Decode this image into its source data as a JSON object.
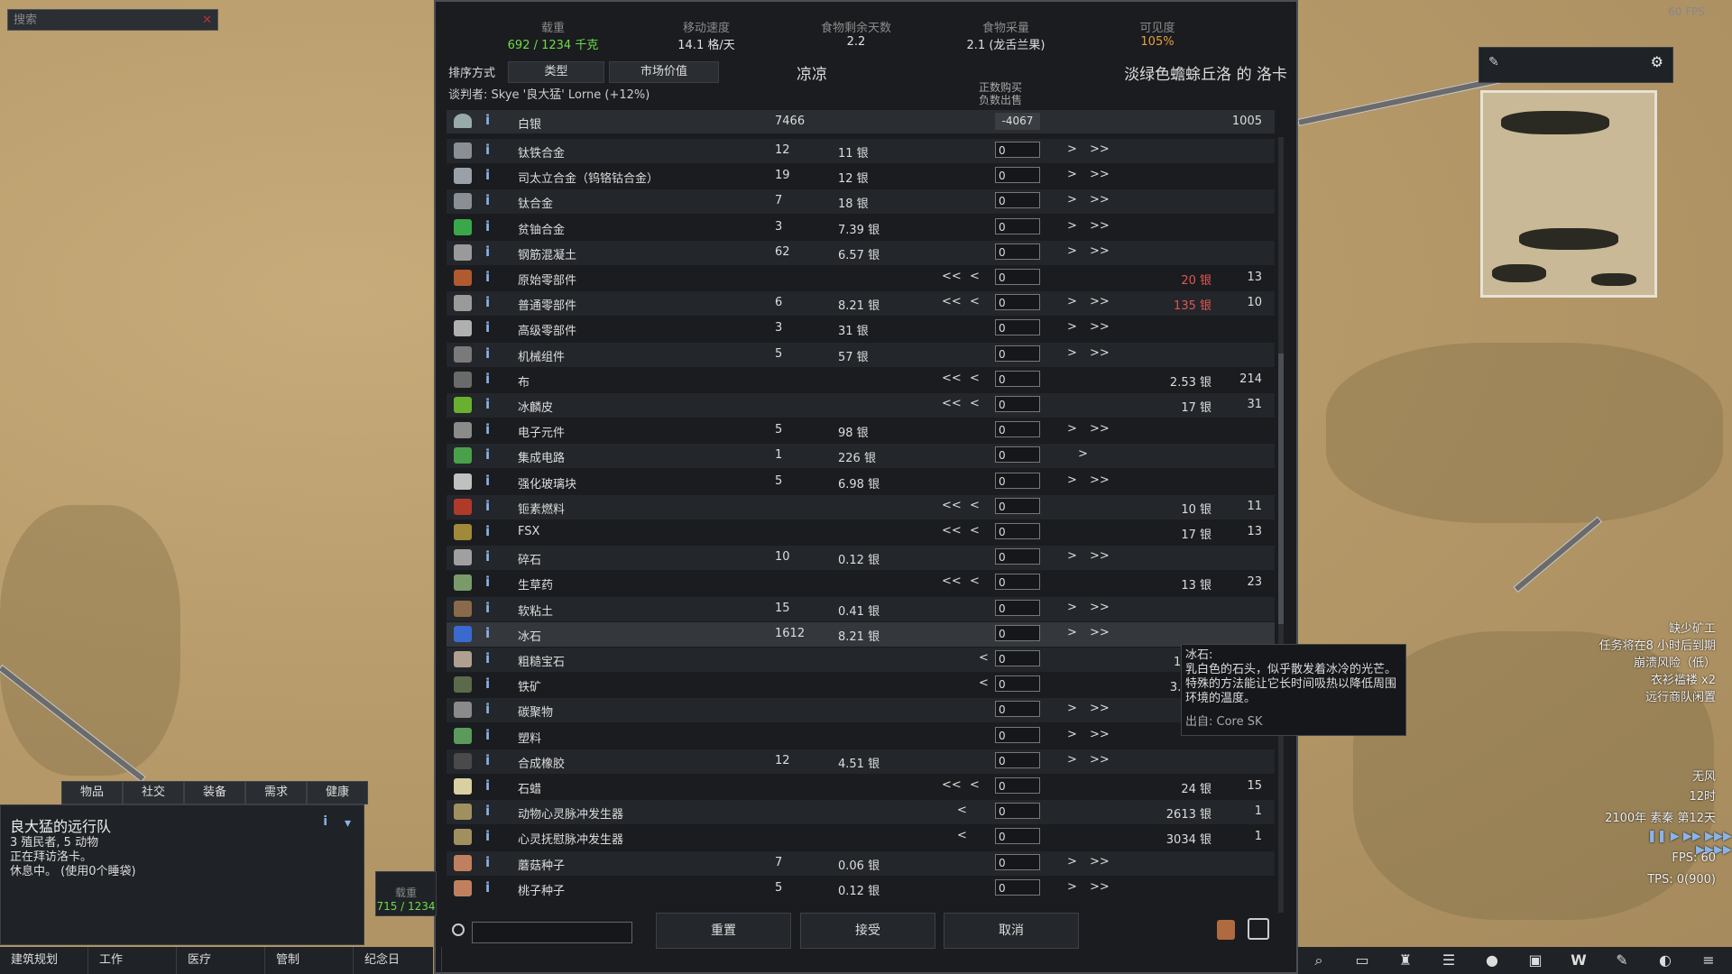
{
  "search": {
    "placeholder": "搜索"
  },
  "top_right": {
    "fps": "60 FPS"
  },
  "stats": [
    {
      "label": "载重",
      "value": "692 / 1234 千克",
      "color": "#6fdc4a"
    },
    {
      "label": "移动速度",
      "value": "14.1 格/天",
      "color": "#e0e0e0"
    },
    {
      "label": "食物剩余天数",
      "value": "2.2",
      "color": "#e0e0e0"
    },
    {
      "label": "食物采量",
      "value": "2.1 (龙舌兰果)",
      "color": "#e0e0e0"
    },
    {
      "label": "可见度",
      "value": "105%",
      "color": "#e8a040"
    }
  ],
  "sort": {
    "label": "排序方式",
    "btn1": "类型",
    "btn2": "市场价值"
  },
  "colony_name": "凉凉",
  "trader_name": "淡绿色蟾蜍丘洛 的 洛卡",
  "negotiator": "谈判者: Skye '良大猛' Lorne (+12%)",
  "hint": {
    "line1": "正数购买",
    "line2": "负数出售"
  },
  "silver": {
    "name": "白银",
    "colony_count": "7466",
    "qty": "-4067",
    "trader_count": "1005"
  },
  "rows": [
    {
      "icon_color": "#8a8f96",
      "name": "钛铁合金",
      "count": "12",
      "price": "11 银",
      "buy_left": false,
      "sell_right": true,
      "trader_price": "",
      "trader_count": "",
      "price_red": false
    },
    {
      "icon_color": "#9aa0a8",
      "name": "司太立合金（钨铬钴合金）",
      "count": "19",
      "price": "12 银",
      "buy_left": false,
      "sell_right": true,
      "trader_price": "",
      "trader_count": "",
      "price_red": false
    },
    {
      "icon_color": "#8a8f96",
      "name": "钛合金",
      "count": "7",
      "price": "18 银",
      "buy_left": false,
      "sell_right": true,
      "trader_price": "",
      "trader_count": "",
      "price_red": false
    },
    {
      "icon_color": "#3aa84a",
      "name": "贫铀合金",
      "count": "3",
      "price": "7.39 银",
      "buy_left": false,
      "sell_right": true,
      "trader_price": "",
      "trader_count": "",
      "price_red": false
    },
    {
      "icon_color": "#9a9a9a",
      "name": "钢筋混凝土",
      "count": "62",
      "price": "6.57 银",
      "buy_left": false,
      "sell_right": true,
      "trader_price": "",
      "trader_count": "",
      "price_red": false
    },
    {
      "icon_color": "#b05a30",
      "name": "原始零部件",
      "count": "",
      "price": "",
      "buy_left": true,
      "sell_right": false,
      "trader_price": "20 银",
      "trader_count": "13",
      "price_red": true
    },
    {
      "icon_color": "#9a9a9a",
      "name": "普通零部件",
      "count": "6",
      "price": "8.21 银",
      "buy_left": true,
      "sell_right": true,
      "trader_price": "135 银",
      "trader_count": "10",
      "price_red": true
    },
    {
      "icon_color": "#b0b0b0",
      "name": "高级零部件",
      "count": "3",
      "price": "31 银",
      "buy_left": false,
      "sell_right": true,
      "trader_price": "",
      "trader_count": "",
      "price_red": false
    },
    {
      "icon_color": "#7a7a7a",
      "name": "机械组件",
      "count": "5",
      "price": "57 银",
      "buy_left": false,
      "sell_right": true,
      "trader_price": "",
      "trader_count": "",
      "price_red": false
    },
    {
      "icon_color": "#6a6a6a",
      "name": "布",
      "count": "",
      "price": "",
      "buy_left": true,
      "sell_right": false,
      "trader_price": "2.53 银",
      "trader_count": "214",
      "price_red": false
    },
    {
      "icon_color": "#6ab030",
      "name": "冰麟皮",
      "count": "",
      "price": "",
      "buy_left": true,
      "sell_right": false,
      "trader_price": "17 银",
      "trader_count": "31",
      "price_red": false
    },
    {
      "icon_color": "#8a8a8a",
      "name": "电子元件",
      "count": "5",
      "price": "98 银",
      "buy_left": false,
      "sell_right": true,
      "trader_price": "",
      "trader_count": "",
      "price_red": false
    },
    {
      "icon_color": "#4aa04a",
      "name": "集成电路",
      "count": "1",
      "price": "226 银",
      "buy_left": false,
      "sell_right": "single",
      "trader_price": "",
      "trader_count": "",
      "price_red": false
    },
    {
      "icon_color": "#c0c0c0",
      "name": "强化玻璃块",
      "count": "5",
      "price": "6.98 银",
      "buy_left": false,
      "sell_right": true,
      "trader_price": "",
      "trader_count": "",
      "price_red": false
    },
    {
      "icon_color": "#b03a2a",
      "name": "钷素燃料",
      "count": "",
      "price": "",
      "buy_left": true,
      "sell_right": false,
      "trader_price": "10 银",
      "trader_count": "11",
      "price_red": false
    },
    {
      "icon_color": "#a08a3a",
      "name": "FSX",
      "count": "",
      "price": "",
      "buy_left": true,
      "sell_right": false,
      "trader_price": "17 银",
      "trader_count": "13",
      "price_red": false
    },
    {
      "icon_color": "#a0a0a0",
      "name": "碎石",
      "count": "10",
      "price": "0.12 银",
      "buy_left": false,
      "sell_right": true,
      "trader_price": "",
      "trader_count": "",
      "price_red": false
    },
    {
      "icon_color": "#7a9a6a",
      "name": "生草药",
      "count": "",
      "price": "",
      "buy_left": true,
      "sell_right": false,
      "trader_price": "13 银",
      "trader_count": "23",
      "price_red": false
    },
    {
      "icon_color": "#8a6a4a",
      "name": "软粘土",
      "count": "15",
      "price": "0.41 银",
      "buy_left": false,
      "sell_right": true,
      "trader_price": "",
      "trader_count": "",
      "price_red": false
    },
    {
      "icon_color": "#3a6ad0",
      "name": "冰石",
      "count": "1612",
      "price": "8.21 银",
      "buy_left": false,
      "sell_right": true,
      "trader_price": "",
      "trader_count": "",
      "price_red": false,
      "highlight": true
    },
    {
      "icon_color": "#b0a090",
      "name": "粗糙宝石",
      "count": "",
      "price": "",
      "buy_left": "partial",
      "sell_right": false,
      "trader_price": "169 银",
      "trader_count": "3",
      "price_red": false
    },
    {
      "icon_color": "#5a6a4a",
      "name": "铁矿",
      "count": "",
      "price": "",
      "buy_left": "partial",
      "sell_right": false,
      "trader_price": "3.37 银",
      "trader_count": "520",
      "price_red": false
    },
    {
      "icon_color": "#8a8a8a",
      "name": "碳聚物",
      "count": "",
      "price": "",
      "buy_left": false,
      "sell_right": true,
      "trader_price": "",
      "trader_count": "",
      "price_red": false
    },
    {
      "icon_color": "#5a9a5a",
      "name": "塑料",
      "count": "",
      "price": "",
      "buy_left": false,
      "sell_right": true,
      "trader_price": "",
      "trader_count": "",
      "price_red": false
    },
    {
      "icon_color": "#4a4a4a",
      "name": "合成橡胶",
      "count": "12",
      "price": "4.51 银",
      "buy_left": false,
      "sell_right": true,
      "trader_price": "",
      "trader_count": "",
      "price_red": false
    },
    {
      "icon_color": "#d8d0a0",
      "name": "石蜡",
      "count": "",
      "price": "",
      "buy_left": true,
      "sell_right": false,
      "trader_price": "24 银",
      "trader_count": "15",
      "price_red": false
    },
    {
      "icon_color": "#a09060",
      "name": "动物心灵脉冲发生器",
      "count": "",
      "price": "",
      "buy_left": "single",
      "sell_right": false,
      "trader_price": "2613 银",
      "trader_count": "1",
      "price_red": false
    },
    {
      "icon_color": "#a09060",
      "name": "心灵抚慰脉冲发生器",
      "count": "",
      "price": "",
      "buy_left": "single",
      "sell_right": false,
      "trader_price": "3034 银",
      "trader_count": "1",
      "price_red": false
    },
    {
      "icon_color": "#c08060",
      "name": "蘑菇种子",
      "count": "7",
      "price": "0.06 银",
      "buy_left": false,
      "sell_right": true,
      "trader_price": "",
      "trader_count": "",
      "price_red": false
    },
    {
      "icon_color": "#c08060",
      "name": "桃子种子",
      "count": "5",
      "price": "0.12 银",
      "buy_left": false,
      "sell_right": true,
      "trader_price": "",
      "trader_count": "",
      "price_red": false
    }
  ],
  "qty_default": "0",
  "arrows": {
    "ll": "<<",
    "l": "<",
    "r": ">",
    "rr": ">>"
  },
  "tooltip": {
    "title": "冰石:",
    "body": "乳白色的石头，似乎散发着冰冷的光芒。特殊的方法能让它长时间吸热以降低周围环境的温度。",
    "source": "出自: Core SK"
  },
  "buttons": {
    "reset": "重置",
    "accept": "接受",
    "cancel": "取消"
  },
  "caravan_tabs": [
    "物品",
    "社交",
    "装备",
    "需求",
    "健康"
  ],
  "caravan": {
    "title": "良大猛的远行队",
    "line1": "3 殖民者, 5 动物",
    "line2": "正在拜访洛卡。",
    "line3": "休息中。 (使用0个睡袋)"
  },
  "mass_mini": {
    "label": "载重",
    "value": "715 / 1234"
  },
  "mainbar": [
    "建筑规划",
    "工作",
    "医疗",
    "管制",
    "纪念日"
  ],
  "alerts": [
    "缺少矿工",
    "任务将在8 小时后到期",
    "崩溃风险（低）",
    "衣衫褴褛 x2",
    "远行商队闲置"
  ],
  "weather": {
    "wind": "无风",
    "time": "12时",
    "date": "2100年 素秦 第12天",
    "fps": "FPS: 60",
    "tps": "TPS: 0(900)"
  }
}
